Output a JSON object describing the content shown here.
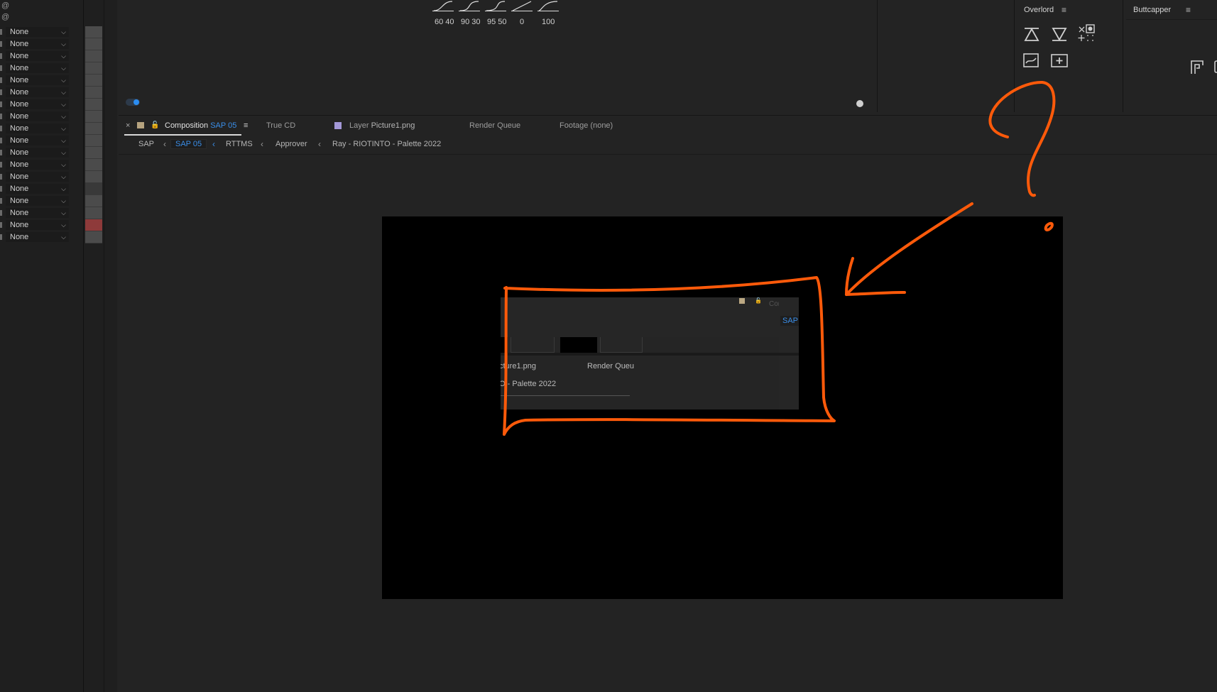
{
  "left_panel": {
    "parent_options": [
      "None",
      "None",
      "None",
      "None",
      "None",
      "None",
      "None",
      "None",
      "None",
      "None",
      "None",
      "None",
      "None",
      "None",
      "None",
      "None",
      "None",
      "None"
    ]
  },
  "top": {
    "graph_labels": [
      "60 40",
      "90 30",
      "95 50",
      "0",
      "100"
    ]
  },
  "overlord": {
    "title": "Overlord",
    "menu": "≡"
  },
  "buttcapper": {
    "title": "Buttcapper",
    "menu": "≡"
  },
  "comp": {
    "tabs": {
      "close": "×",
      "composition_label": "Composition",
      "composition_name": "SAP 05",
      "menu": "≡",
      "true_cd": "True CD",
      "layer_label": "Layer",
      "layer_name": "Picture1.png",
      "render_queue": "Render Queue",
      "footage": "Footage (none)"
    },
    "breadcrumbs": [
      "SAP",
      "SAP 05",
      "RTTMS",
      "Approver",
      "Ray - RIOTINTO - Palette 2022"
    ]
  },
  "nested": {
    "text1": "cture1.png",
    "text2": "Render Queu",
    "text3": "O - Palette 2022",
    "sap": "SAP",
    "compos": "Compos"
  },
  "colors": {
    "annotation": "#ff5a0a",
    "accent": "#3a8ee8"
  }
}
